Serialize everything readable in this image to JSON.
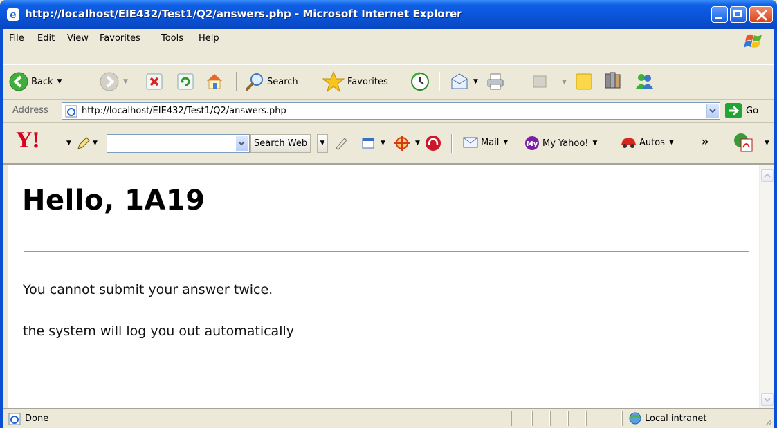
{
  "window": {
    "title": "http://localhost/EIE432/Test1/Q2/answers.php - Microsoft Internet Explorer",
    "app_icon_glyph": "e"
  },
  "menu": {
    "items": [
      "File",
      "Edit",
      "View",
      "Favorites",
      "Tools",
      "Help"
    ]
  },
  "toolbar": {
    "back_label": "Back",
    "search_label": "Search",
    "favorites_label": "Favorites"
  },
  "address": {
    "label": "Address",
    "url": "http://localhost/EIE432/Test1/Q2/answers.php",
    "go_label": "Go"
  },
  "yahoo": {
    "logo_text": "Y!",
    "search_value": "",
    "search_web_label": "Search Web",
    "mail_label": "Mail",
    "my_yahoo_label": "My Yahoo!",
    "autos_label": "Autos",
    "more_label": "»"
  },
  "page": {
    "heading": "Hello, 1A19",
    "messages": [
      "You cannot submit your answer twice.",
      "the system will log you out automatically"
    ]
  },
  "status": {
    "text": "Done",
    "zone": "Local intranet"
  },
  "colors": {
    "titlebar": "#0a54d8",
    "chrome": "#ece9d8",
    "content_bg": "#ffffff",
    "yahoo_red": "#d7001f"
  }
}
